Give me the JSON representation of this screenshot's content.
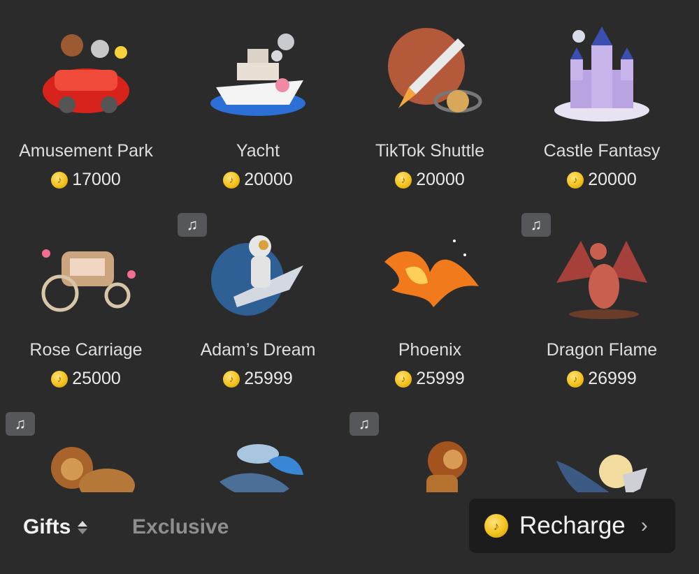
{
  "gifts": [
    {
      "name": "Amusement Park",
      "price": "17000",
      "icon": "amusement-park-car-icon",
      "music": false
    },
    {
      "name": "Yacht",
      "price": "20000",
      "icon": "yacht-icon",
      "music": false
    },
    {
      "name": "TikTok Shuttle",
      "price": "20000",
      "icon": "rocket-shuttle-icon",
      "music": false
    },
    {
      "name": "Castle Fantasy",
      "price": "20000",
      "icon": "castle-icon",
      "music": false
    },
    {
      "name": "Rose Carriage",
      "price": "25000",
      "icon": "carriage-icon",
      "music": false
    },
    {
      "name": "Adam’s Dream",
      "price": "25999",
      "icon": "astronaut-icon",
      "music": true
    },
    {
      "name": "Phoenix",
      "price": "25999",
      "icon": "phoenix-icon",
      "music": false
    },
    {
      "name": "Dragon Flame",
      "price": "26999",
      "icon": "dragon-icon",
      "music": true
    },
    {
      "name": "",
      "price": "",
      "icon": "lion-icon",
      "music": true
    },
    {
      "name": "",
      "price": "",
      "icon": "whale-wave-icon",
      "music": false
    },
    {
      "name": "",
      "price": "",
      "icon": "roaring-lion-icon",
      "music": true
    },
    {
      "name": "",
      "price": "",
      "icon": "whale-moon-icon",
      "music": false
    }
  ],
  "tabs": {
    "gifts": "Gifts",
    "exclusive": "Exclusive"
  },
  "recharge": {
    "label": "Recharge",
    "chevron": "›"
  },
  "coin_glyph": "♪",
  "music_glyph": "♫",
  "colors": {
    "background": "#2b2b2b",
    "coin": "#f3c21c",
    "badge": "#55575b",
    "recharge_bg": "#1c1c1c"
  }
}
